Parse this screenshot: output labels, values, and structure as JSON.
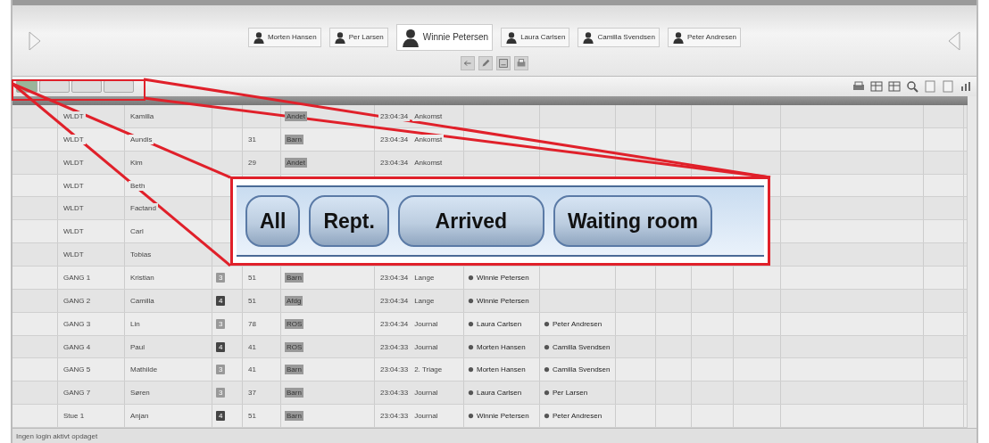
{
  "staff": [
    {
      "name": "Morten Hansen",
      "large": false
    },
    {
      "name": "Per Larsen",
      "large": false
    },
    {
      "name": "Winnie Petersen",
      "large": true
    },
    {
      "name": "Laura Carlsen",
      "large": false
    },
    {
      "name": "Camilla Svendsen",
      "large": false
    },
    {
      "name": "Peter Andresen",
      "large": false
    }
  ],
  "tabs": [
    {
      "selected": true
    },
    {
      "selected": false
    },
    {
      "selected": false
    },
    {
      "selected": false
    }
  ],
  "table": {
    "rows": [
      {
        "code": "WLDT",
        "name": "Kamilla",
        "num": "",
        "tag": "Andet",
        "time": "23:04:34",
        "status": "Ankomst"
      },
      {
        "code": "WLDT",
        "name": "Aundis",
        "num": "31",
        "tag": "Barn",
        "time": "23:04:34",
        "status": "Ankomst"
      },
      {
        "code": "WLDT",
        "name": "Kim",
        "num": "29",
        "tag": "Andet",
        "time": "23:04:34",
        "status": "Ankomst"
      },
      {
        "code": "WLDT",
        "name": "Beth"
      },
      {
        "code": "WLDT",
        "name": "Factand"
      },
      {
        "code": "WLDT",
        "name": "Carl"
      },
      {
        "code": "WLDT",
        "name": "Tobias"
      },
      {
        "code": "GANG 1",
        "name": "Kristian",
        "badge": "3",
        "urgent": false,
        "num": "51",
        "tag": "Barn",
        "time": "23:04:34",
        "status": "Lange",
        "person_1": "Winnie Petersen"
      },
      {
        "code": "GANG 2",
        "name": "Camilla",
        "badge": "4",
        "urgent": true,
        "num": "51",
        "tag": "Afdg",
        "time": "23:04:34",
        "status": "Lange",
        "person_1": "Winnie Petersen"
      },
      {
        "code": "GANG 3",
        "name": "Lin",
        "badge": "3",
        "urgent": false,
        "num": "78",
        "tag": "ROS",
        "time": "23:04:34",
        "status": "Journal",
        "person_1": "Laura Carlsen",
        "person_2": "Peter Andresen"
      },
      {
        "code": "GANG 4",
        "name": "Paul",
        "badge": "4",
        "urgent": true,
        "num": "41",
        "tag": "ROS",
        "time": "23:04:33",
        "status": "Journal",
        "person_1": "Morten Hansen",
        "person_2": "Camilla Svendsen"
      },
      {
        "code": "GANG 5",
        "name": "Mathilde",
        "badge": "3",
        "urgent": false,
        "num": "41",
        "tag": "Barn",
        "time": "23:04:33",
        "status": "2. Triage",
        "person_1": "Morten Hansen",
        "person_2": "Camilla Svendsen"
      },
      {
        "code": "GANG 7",
        "name": "Søren",
        "badge": "3",
        "urgent": false,
        "num": "37",
        "tag": "Barn",
        "time": "23:04:33",
        "status": "Journal",
        "person_1": "Laura Carlsen",
        "person_2": "Per Larsen"
      },
      {
        "code": "Stue 1",
        "name": "Anjan",
        "badge": "4",
        "urgent": true,
        "num": "51",
        "tag": "Barn",
        "time": "23:04:33",
        "status": "Journal",
        "person_1": "Winnie Petersen",
        "person_2": "Peter Andresen"
      }
    ]
  },
  "status_bar": "Ingen login aktivt opdaget",
  "callout": {
    "buttons": [
      "All",
      "Rept.",
      "Arrived",
      "Waiting room"
    ]
  }
}
